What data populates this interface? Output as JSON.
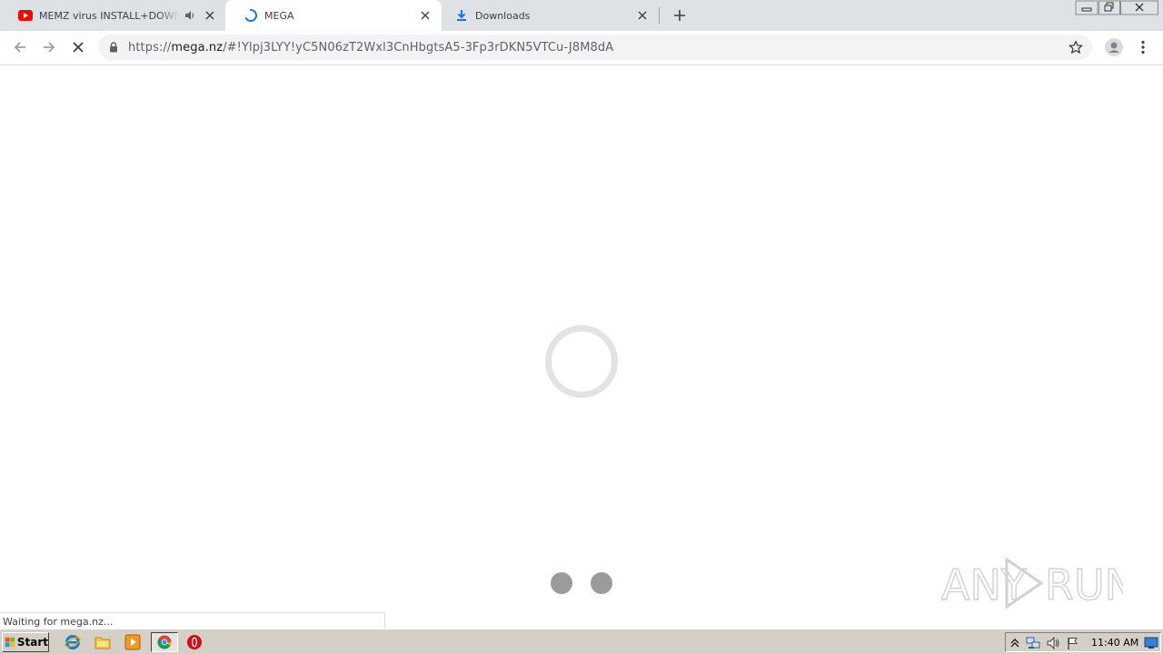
{
  "tabs": [
    {
      "title": "MEMZ virus INSTALL+DOWNLOAD",
      "favicon": "youtube-icon",
      "audio": "speaker-icon",
      "active": false
    },
    {
      "title": "MEGA",
      "favicon": "loading-spinner-icon",
      "active": true
    },
    {
      "title": "Downloads",
      "favicon": "download-icon",
      "active": false
    }
  ],
  "toolbar": {
    "url_scheme": "https://",
    "url_host": "mega.nz",
    "url_path": "/#!Ylpj3LYY!yC5N06zT2Wxl3CnHbgtsA5-3Fp3rDKN5VTCu-J8M8dA"
  },
  "status": {
    "text": "Waiting for mega.nz..."
  },
  "watermark": {
    "text": "ANY RUN"
  },
  "taskbar": {
    "start_label": "Start",
    "clock": "11:40 AM"
  },
  "colors": {
    "tabstrip_bg": "#dee1e6",
    "accent_blue": "#1a73e8",
    "youtube_red": "#ff0000",
    "spinner_gray": "#e3e3e3",
    "dot_gray": "#9b9b9b",
    "taskbar_bg": "#d4d0c8"
  }
}
